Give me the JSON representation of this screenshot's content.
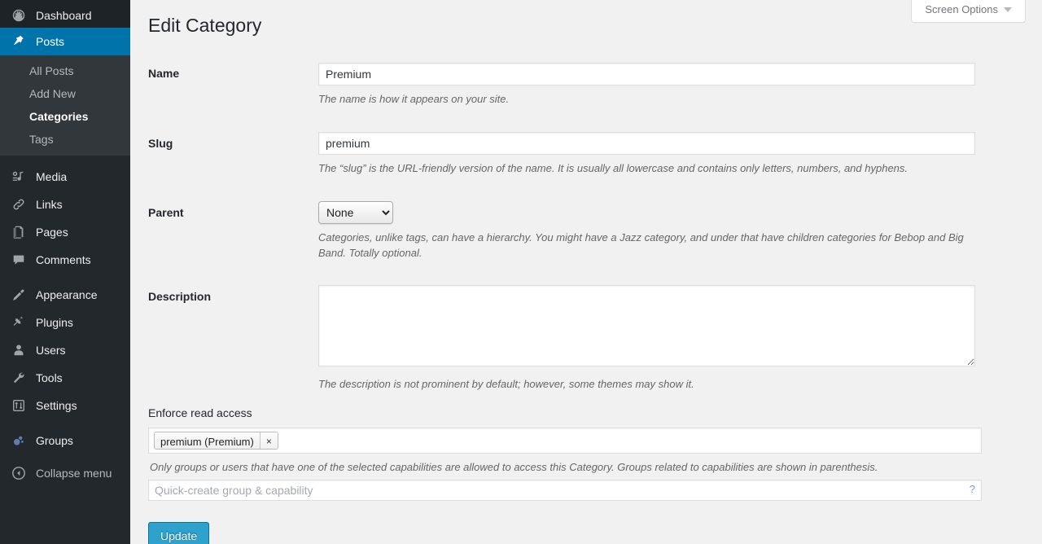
{
  "sidebar": {
    "items": [
      {
        "label": "Dashboard",
        "icon": "dashboard-icon",
        "state": "first"
      },
      {
        "label": "Posts",
        "icon": "pin-icon",
        "state": "current"
      },
      {
        "label": "Media",
        "icon": "media-icon",
        "state": "normal"
      },
      {
        "label": "Links",
        "icon": "link-icon",
        "state": "normal"
      },
      {
        "label": "Pages",
        "icon": "pages-icon",
        "state": "normal"
      },
      {
        "label": "Comments",
        "icon": "comments-icon",
        "state": "normal"
      },
      {
        "label": "Appearance",
        "icon": "appearance-icon",
        "state": "normal"
      },
      {
        "label": "Plugins",
        "icon": "plugins-icon",
        "state": "normal"
      },
      {
        "label": "Users",
        "icon": "users-icon",
        "state": "normal"
      },
      {
        "label": "Tools",
        "icon": "tools-icon",
        "state": "normal"
      },
      {
        "label": "Settings",
        "icon": "settings-icon",
        "state": "normal"
      },
      {
        "label": "Groups",
        "icon": "groups-icon",
        "state": "normal"
      }
    ],
    "submenu": [
      {
        "label": "All Posts",
        "current": false
      },
      {
        "label": "Add New",
        "current": false
      },
      {
        "label": "Categories",
        "current": true
      },
      {
        "label": "Tags",
        "current": false
      }
    ],
    "collapse": {
      "label": "Collapse menu",
      "icon": "collapse-arrow-icon"
    }
  },
  "header": {
    "title": "Edit Category",
    "screen_options_label": "Screen Options"
  },
  "form": {
    "name": {
      "label": "Name",
      "value": "Premium",
      "placeholder": "",
      "description": "The name is how it appears on your site."
    },
    "slug": {
      "label": "Slug",
      "value": "premium",
      "placeholder": "",
      "description": "The “slug” is the URL-friendly version of the name. It is usually all lowercase and contains only letters, numbers, and hyphens."
    },
    "parent": {
      "label": "Parent",
      "selected": "None",
      "options": [
        "None"
      ],
      "description": "Categories, unlike tags, can have a hierarchy. You might have a Jazz category, and under that have children categories for Bebop and Big Band. Totally optional."
    },
    "description": {
      "label": "Description",
      "value": "",
      "description": "The description is not prominent by default; however, some themes may show it."
    }
  },
  "access": {
    "label": "Enforce read access",
    "chips": [
      {
        "text": "premium (Premium)",
        "remove": "×"
      }
    ],
    "description": "Only groups or users that have one of the selected capabilities are allowed to access this Category. Groups related to capabilities are shown in parenthesis.",
    "quick_create_placeholder": "Quick-create group & capability",
    "quick_create_value": "",
    "help": "?"
  },
  "submit": {
    "update_label": "Update"
  },
  "colors": {
    "accent": "#0073aa",
    "button_primary": "#2ea2cc",
    "sidebar_bg": "#23282d",
    "submenu_bg": "#32373c",
    "content_bg": "#f1f1f1",
    "groups_icon": "#5c7fb0"
  }
}
